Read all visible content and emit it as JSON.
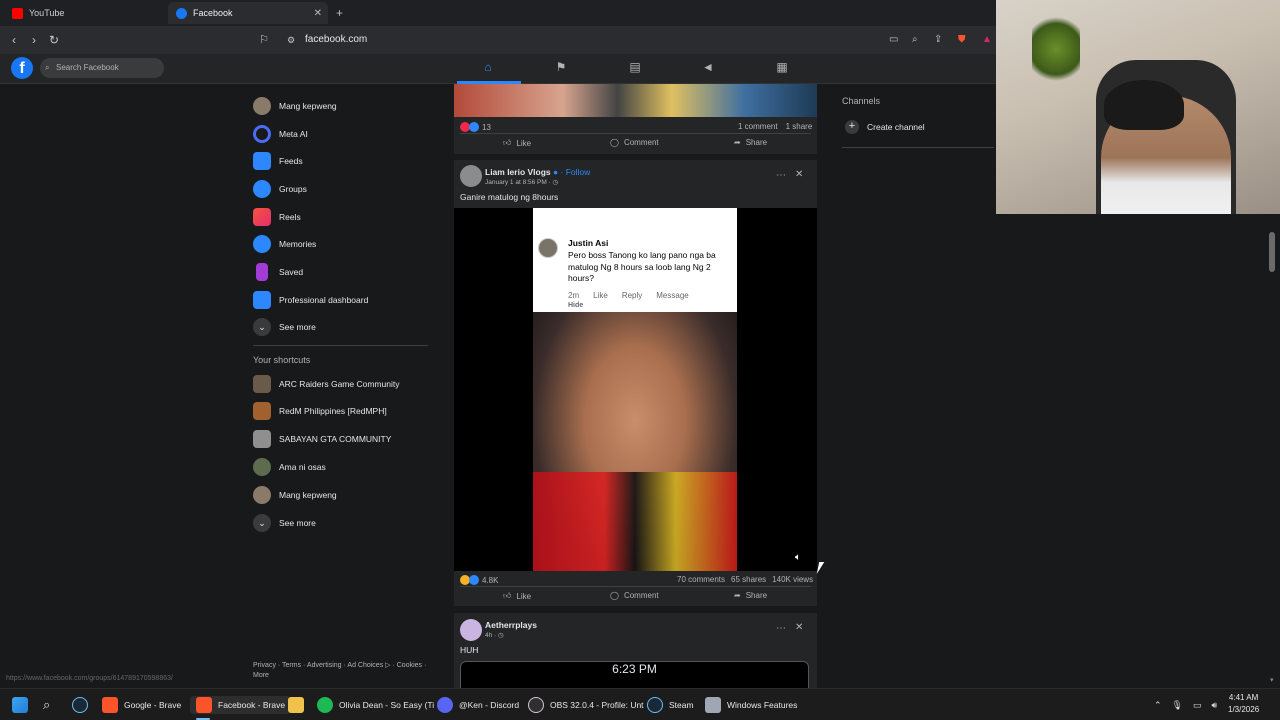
{
  "browser": {
    "tabs": [
      {
        "label": "YouTube",
        "active": false,
        "favicon_color": "#ff0000"
      },
      {
        "label": "Facebook",
        "active": true,
        "favicon_color": "#1877f2"
      }
    ],
    "url": "facebook.com",
    "status_url": "https://www.facebook.com/groups/614789170598863/"
  },
  "facebook": {
    "logo": "f",
    "search_placeholder": "Search Facebook",
    "nav_icons": [
      "home-icon",
      "flag-icon",
      "marketplace-icon",
      "megaphone-icon",
      "calendar-icon"
    ],
    "left_menu": [
      {
        "label": "Mang kepweng",
        "icon": "profile-avatar"
      },
      {
        "label": "Meta AI",
        "icon": "meta-ai-icon"
      },
      {
        "label": "Feeds",
        "icon": "feeds-icon"
      },
      {
        "label": "Groups",
        "icon": "groups-icon"
      },
      {
        "label": "Reels",
        "icon": "reels-icon"
      },
      {
        "label": "Memories",
        "icon": "memories-icon"
      },
      {
        "label": "Saved",
        "icon": "saved-icon"
      },
      {
        "label": "Professional dashboard",
        "icon": "dashboard-icon"
      },
      {
        "label": "See more",
        "icon": "chevron-down-icon"
      }
    ],
    "shortcuts_title": "Your shortcuts",
    "shortcuts": [
      {
        "label": "ARC Raiders Game Community"
      },
      {
        "label": "RedM Philippines [RedMPH]"
      },
      {
        "label": "SABAYAN GTA COMMUNITY"
      },
      {
        "label": "Ama ni osas"
      },
      {
        "label": "Mang kepweng"
      },
      {
        "label": "See more"
      }
    ],
    "footer": "Privacy · Terms · Advertising · Ad Choices ▷ · Cookies · More",
    "right": {
      "channels_title": "Channels",
      "create_channel": "Create channel"
    }
  },
  "posts": [
    {
      "reaction_count": "13",
      "comments": "1 comment",
      "shares": "1 share",
      "actions": [
        "Like",
        "Comment",
        "Share"
      ]
    },
    {
      "author": "Liam Ierio Vlogs",
      "follow": "· Follow",
      "time": "January 1 at 8:56 PM · ◷",
      "caption": "Ganire matulog ng 8hours",
      "overlay_comment": {
        "name": "Justin Asi",
        "text": "Pero boss Tanong ko lang pano nga ba matulog Ng 8 hours sa loob lang Ng 2 hours?",
        "time": "2m",
        "like": "Like",
        "reply": "Reply",
        "message": "Message",
        "hide": "Hide"
      },
      "reaction_count": "4.8K",
      "comments": "70 comments",
      "shares": "65 shares",
      "views": "140K views",
      "actions": [
        "Like",
        "Comment",
        "Share"
      ]
    },
    {
      "author": "Aetherrplays",
      "time": "4h · ◷",
      "caption": "HUH",
      "image_text": "6:23 PM"
    }
  ],
  "taskbar": {
    "items": [
      {
        "label": "Google - Brave",
        "icon_color": "#fb542b"
      },
      {
        "label": "Facebook - Brave",
        "icon_color": "#fb542b",
        "active": true
      },
      {
        "label": "Olivia Dean - So Easy (Ti",
        "icon_color": "#1db954"
      },
      {
        "label": "@Ken - Discord",
        "icon_color": "#5865f2"
      },
      {
        "label": "OBS 32.0.4 - Profile: Unt",
        "icon_color": "#302e31"
      },
      {
        "label": "Steam",
        "icon_color": "#1b2838"
      },
      {
        "label": "Windows Features",
        "icon_color": "#9ea7b3"
      }
    ],
    "time": "4:41 AM",
    "date": "1/3/2026"
  }
}
